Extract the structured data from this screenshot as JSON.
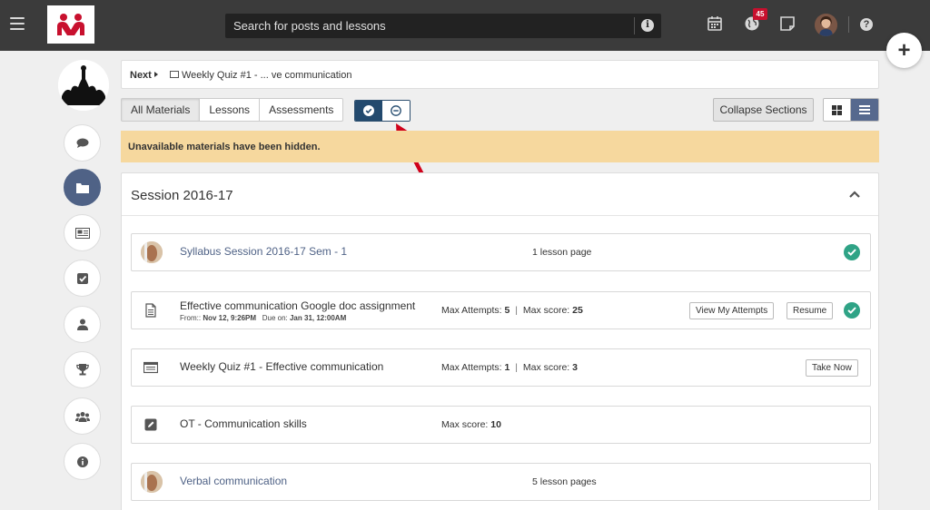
{
  "search": {
    "placeholder": "Search for posts and lessons"
  },
  "notifications": {
    "count": "45"
  },
  "breadcrumb": {
    "next_label": "Next",
    "current": "Weekly Quiz #1 - ... ve communication"
  },
  "filters": {
    "tabs": [
      "All Materials",
      "Lessons",
      "Assessments"
    ],
    "active": "All Materials"
  },
  "toolbar": {
    "collapse_label": "Collapse Sections"
  },
  "banner": {
    "text": "Unavailable materials have been hidden."
  },
  "session": {
    "title": "Session 2016-17",
    "items": [
      {
        "title": "Syllabus Session 2016-17 Sem - 1",
        "info": "1 lesson page",
        "completed": true
      },
      {
        "title": "Effective communication Google doc assignment",
        "from_label": "From::",
        "from": "Nov 12, 9:26PM",
        "due_label": "Due on:",
        "due": "Jan 31, 12:00AM",
        "attempts_label": "Max Attempts:",
        "attempts": "5",
        "score_label": "Max score:",
        "score": "25",
        "buttons": [
          "View My Attempts",
          "Resume"
        ],
        "completed": true
      },
      {
        "title": "Weekly Quiz #1 - Effective communication",
        "attempts_label": "Max Attempts:",
        "attempts": "1",
        "score_label": "Max score:",
        "score": "3",
        "buttons": [
          "Take Now"
        ]
      },
      {
        "title": "OT - Communication skills",
        "score_label": "Max score:",
        "score": "10"
      },
      {
        "title": "Verbal communication",
        "info": "5 lesson pages"
      }
    ]
  },
  "colors": {
    "topbar": "#3b3b3b",
    "accent": "#4f6286",
    "toggle_on": "#234a6e",
    "banner": "#f6d89e",
    "success": "#2fa386",
    "arrow": "#d0021b",
    "brand": "#c8102e"
  }
}
